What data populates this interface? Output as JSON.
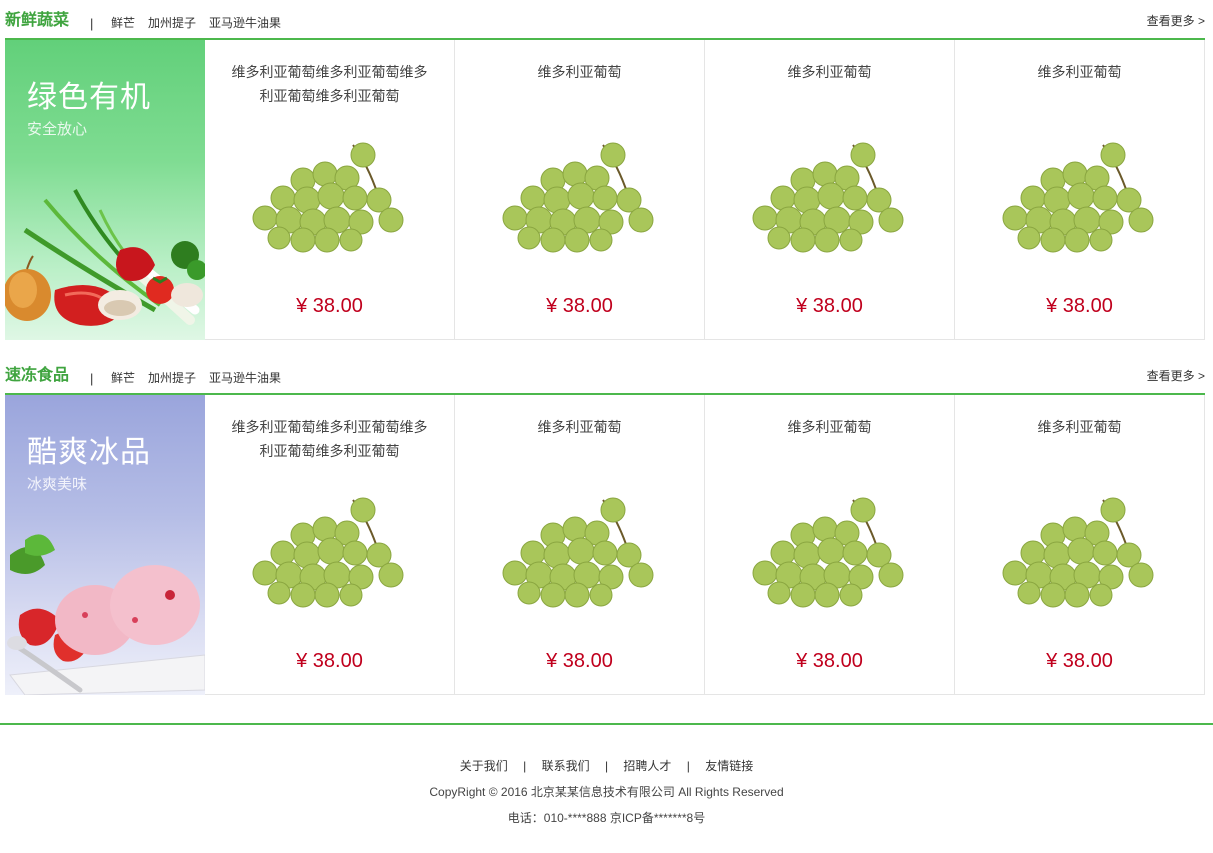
{
  "sections": [
    {
      "title": "新鲜蔬菜",
      "separator": "|",
      "tags": [
        "鲜芒",
        "加州提子",
        "亚马逊牛油果"
      ],
      "more": "查看更多 >",
      "banner": {
        "title": "绿色有机",
        "subtitle": "安全放心",
        "art": "vegetables-image"
      },
      "products": [
        {
          "name": "维多利亚葡萄维多利亚葡萄维多利亚葡萄维多利亚葡萄",
          "price": "¥ 38.00"
        },
        {
          "name": "维多利亚葡萄",
          "price": "¥ 38.00"
        },
        {
          "name": "维多利亚葡萄",
          "price": "¥ 38.00"
        },
        {
          "name": "维多利亚葡萄",
          "price": "¥ 38.00"
        }
      ]
    },
    {
      "title": "速冻食品",
      "separator": "|",
      "tags": [
        "鲜芒",
        "加州提子",
        "亚马逊牛油果"
      ],
      "more": "查看更多 >",
      "banner": {
        "title": "酷爽冰品",
        "subtitle": "冰爽美味",
        "art": "ice-cream-image"
      },
      "products": [
        {
          "name": "维多利亚葡萄维多利亚葡萄维多利亚葡萄维多利亚葡萄",
          "price": "¥ 38.00"
        },
        {
          "name": "维多利亚葡萄",
          "price": "¥ 38.00"
        },
        {
          "name": "维多利亚葡萄",
          "price": "¥ 38.00"
        },
        {
          "name": "维多利亚葡萄",
          "price": "¥ 38.00"
        }
      ]
    }
  ],
  "footer": {
    "links": [
      "关于我们",
      "联系我们",
      "招聘人才",
      "友情链接"
    ],
    "separator": "|",
    "copyright": "CopyRight © 2016 北京某某信息技术有限公司 All Rights Reserved",
    "phone": "电话：010-****888 京ICP备*******8号"
  },
  "colors": {
    "accent": "#4cb84c",
    "title_green": "#3fa43f",
    "price": "#c0001d"
  }
}
